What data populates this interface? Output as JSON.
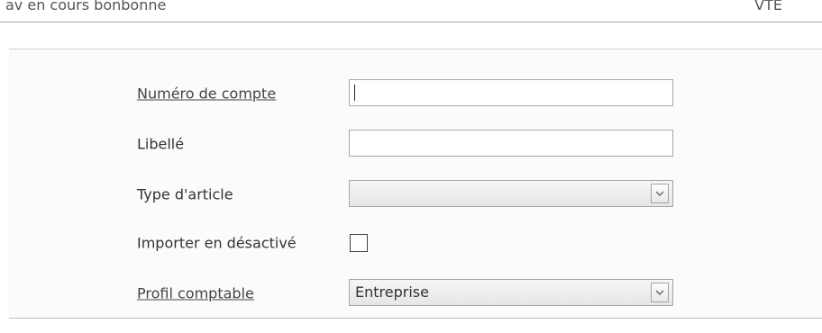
{
  "header": {
    "left_text": "av en cours bonbonne",
    "right_text": "VTE"
  },
  "form": {
    "account_number": {
      "label": "Numéro de compte",
      "value": ""
    },
    "libelle": {
      "label": "Libellé",
      "value": ""
    },
    "article_type": {
      "label": "Type d'article",
      "selected": ""
    },
    "import_disabled": {
      "label": "Importer en désactivé",
      "checked": false
    },
    "accounting_profile": {
      "label": "Profil comptable",
      "selected": "Entreprise"
    }
  },
  "icons": {
    "dropdown": "chevron-down-icon"
  }
}
